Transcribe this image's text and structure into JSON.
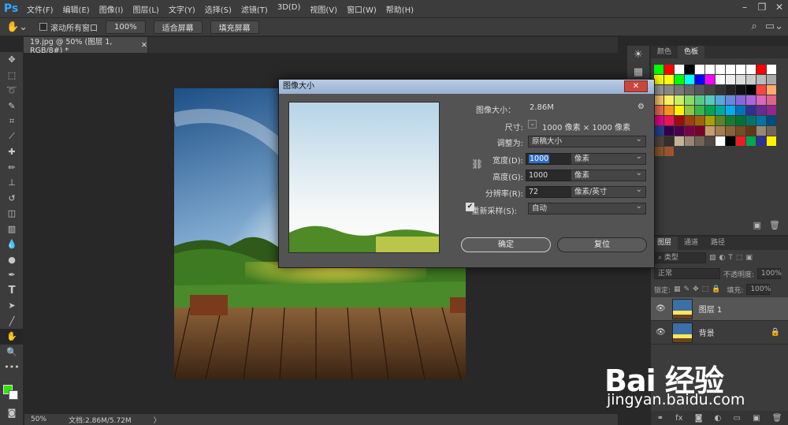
{
  "app": {
    "logo": "Ps"
  },
  "menu": [
    "文件(F)",
    "编辑(E)",
    "图像(I)",
    "图层(L)",
    "文字(Y)",
    "选择(S)",
    "滤镜(T)",
    "3D(D)",
    "视图(V)",
    "窗口(W)",
    "帮助(H)"
  ],
  "options": {
    "scroll_all_label": "滚动所有窗口",
    "zoom_value": "100%",
    "fit_screen_label": "适合屏幕",
    "fill_screen_label": "填充屏幕"
  },
  "document": {
    "tab_title": "19.jpg @ 50% (图层 1, RGB/8#) *",
    "zoom": "50%",
    "doc_info": "文档:2.86M/5.72M"
  },
  "colors": {
    "foreground": "#2fe600",
    "background": "#ffffff",
    "accent": "#31a8ff"
  },
  "dialog": {
    "title": "图像大小",
    "image_size_label": "图像大小：",
    "image_size_value": "2.86M",
    "dimensions_label": "尺寸:",
    "dimensions_value": "1000 像素 × 1000 像素",
    "fit_to_label": "调整为:",
    "fit_to_value": "原稿大小",
    "width_label": "宽度(D):",
    "width_value": "1000",
    "width_unit": "像素",
    "height_label": "高度(G):",
    "height_value": "1000",
    "height_unit": "像素",
    "resolution_label": "分辨率(R):",
    "resolution_value": "72",
    "resolution_unit": "像素/英寸",
    "resample_label": "重新采样(S):",
    "resample_value": "自动",
    "ok_label": "确定",
    "reset_label": "复位"
  },
  "swatches_panel": {
    "tabs": [
      "颜色",
      "色板"
    ],
    "active_tab": "色板"
  },
  "layers_panel": {
    "tabs": [
      "图层",
      "通道",
      "路径"
    ],
    "kind_filter": "类型",
    "blend_mode": "正常",
    "opacity_label": "不透明度:",
    "opacity_value": "100%",
    "lock_label": "锁定:",
    "fill_label": "填充:",
    "fill_value": "100%",
    "layers": [
      {
        "name": "图层 1",
        "selected": true
      },
      {
        "name": "背景",
        "selected": false
      }
    ]
  },
  "watermark": {
    "logo": "Bai 经验",
    "url": "jingyan.baidu.com"
  }
}
